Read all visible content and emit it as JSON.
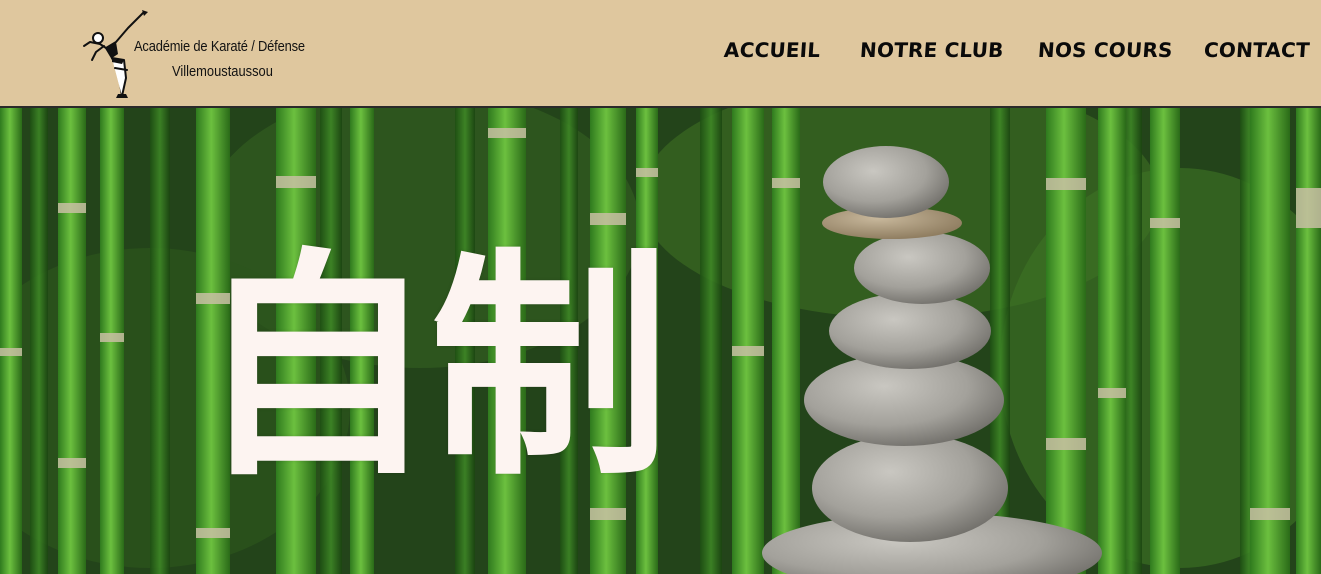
{
  "header": {
    "logo": {
      "line1": "Académie de Karaté / Défense",
      "line2": "Villemoustaussou",
      "icon": "karate-kick-figure"
    },
    "nav": [
      {
        "label": "ACCUEIL"
      },
      {
        "label": "NOTRE CLUB"
      },
      {
        "label": "NOS COURS"
      },
      {
        "label": "CONTACT"
      }
    ],
    "background_color": "#dfc79e"
  },
  "hero": {
    "kanji": "自制",
    "kanji_color": "#fdf4f1",
    "image": "bamboo-and-stacked-stones"
  }
}
